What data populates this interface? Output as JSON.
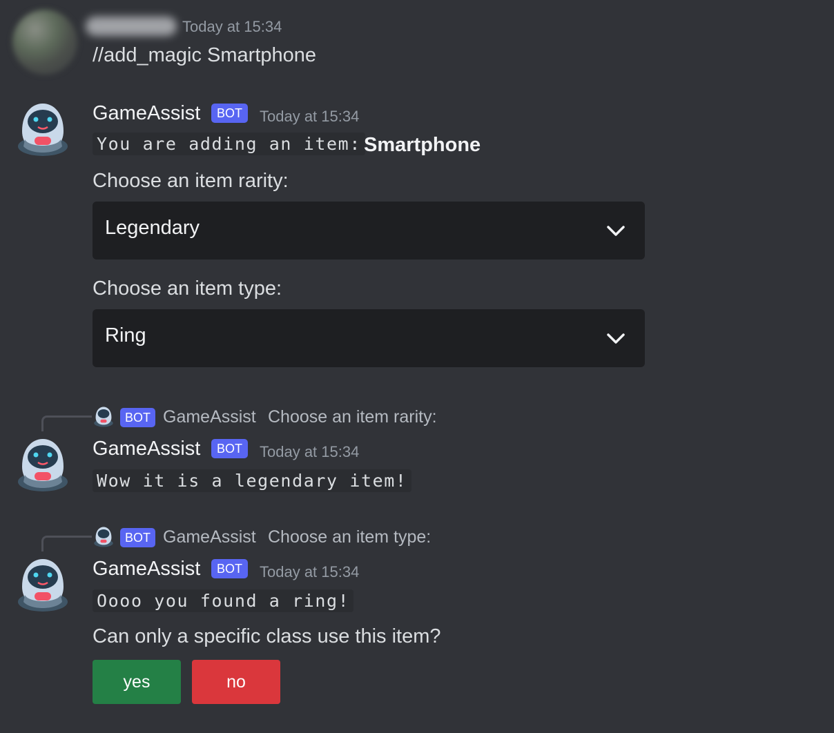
{
  "messages": {
    "user": {
      "timestamp": "Today at 15:34",
      "content": "//add_magic Smartphone"
    },
    "bot1": {
      "username": "GameAssist",
      "badge": "BOT",
      "timestamp": "Today at 15:34",
      "code_text": "You are adding an item:",
      "item_name": "Smartphone",
      "rarity_label": "Choose an item rarity:",
      "rarity_selected": "Legendary",
      "type_label": "Choose an item type:",
      "type_selected": "Ring"
    },
    "bot2": {
      "reply_badge": "BOT",
      "reply_name": "GameAssist",
      "reply_text": "Choose an item rarity:",
      "username": "GameAssist",
      "badge": "BOT",
      "timestamp": "Today at 15:34",
      "code_text": "Wow it is a legendary item!"
    },
    "bot3": {
      "reply_badge": "BOT",
      "reply_name": "GameAssist",
      "reply_text": "Choose an item type:",
      "username": "GameAssist",
      "badge": "BOT",
      "timestamp": "Today at 15:34",
      "code_text": "Oooo you found a ring!",
      "question": "Can only a specific class use this item?",
      "yes_label": "yes",
      "no_label": "no"
    }
  },
  "colors": {
    "background": "#313338",
    "blurple": "#5865f2",
    "success": "#248046",
    "danger": "#da373c",
    "select_bg": "#1e1f22"
  },
  "icons": {
    "bot_avatar": "robot-icon",
    "dropdown": "chevron-down-icon"
  }
}
